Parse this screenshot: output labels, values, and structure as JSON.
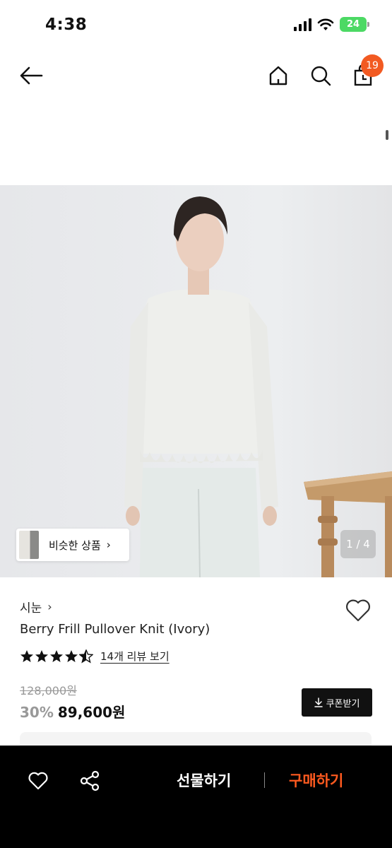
{
  "status_bar": {
    "time": "4:38",
    "battery": "24"
  },
  "header": {
    "cart_count": "19"
  },
  "gallery": {
    "similar_label": "비슷한 상품",
    "page_indicator": "1 / 4"
  },
  "product": {
    "brand": "시눈",
    "title": "Berry Frill Pullover Knit (Ivory)",
    "rating": 4.5,
    "review_link": "14개 리뷰 보기",
    "original_price": "128,000원",
    "discount_rate": "30%",
    "sale_price": "89,600원",
    "coupon_label": "쿠폰받기"
  },
  "bottom_bar": {
    "gift_label": "선물하기",
    "buy_label": "구매하기"
  },
  "colors": {
    "accent": "#ff5a1f",
    "badge": "#f25a22",
    "battery": "#4cd964"
  }
}
